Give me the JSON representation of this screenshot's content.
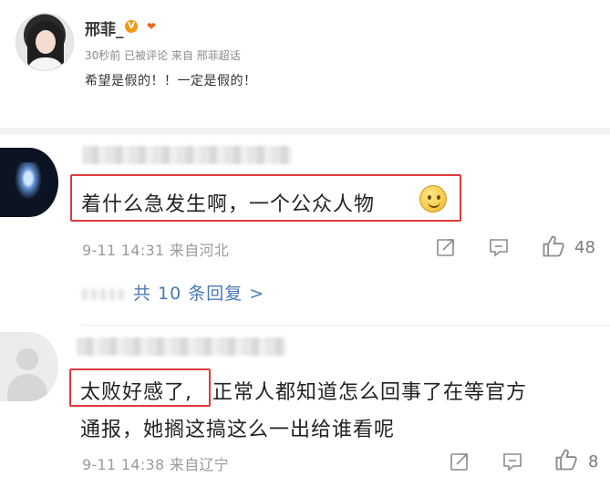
{
  "top_comment": {
    "username": "邢菲_",
    "vip_badge": "V",
    "fan_badge": "❤",
    "meta": "30秒前 已被评论 来自 邢菲超话",
    "text": "希望是假的！！一定是假的！"
  },
  "comments": [
    {
      "text": "着什么急发生啊，一个公众人物",
      "emoji": "smile",
      "meta": "9-11 14:31 来自河北",
      "likes": "48",
      "replies_label": "共 10 条回复 >"
    },
    {
      "text_highlight": "太败好感了,",
      "text_line1_rest": "正常人都知道怎么回事了在等官方",
      "text_line2": "通报，她搁这搞这么一出给谁看呢",
      "meta": "9-11 14:38 来自辽宁",
      "likes": "8"
    }
  ],
  "colors": {
    "highlight_box": "#e03a3a",
    "link": "#4a79b5",
    "meta": "#9a9a9a"
  },
  "icons": [
    "share-icon",
    "comment-icon",
    "like-icon",
    "smile-emoji-icon"
  ]
}
